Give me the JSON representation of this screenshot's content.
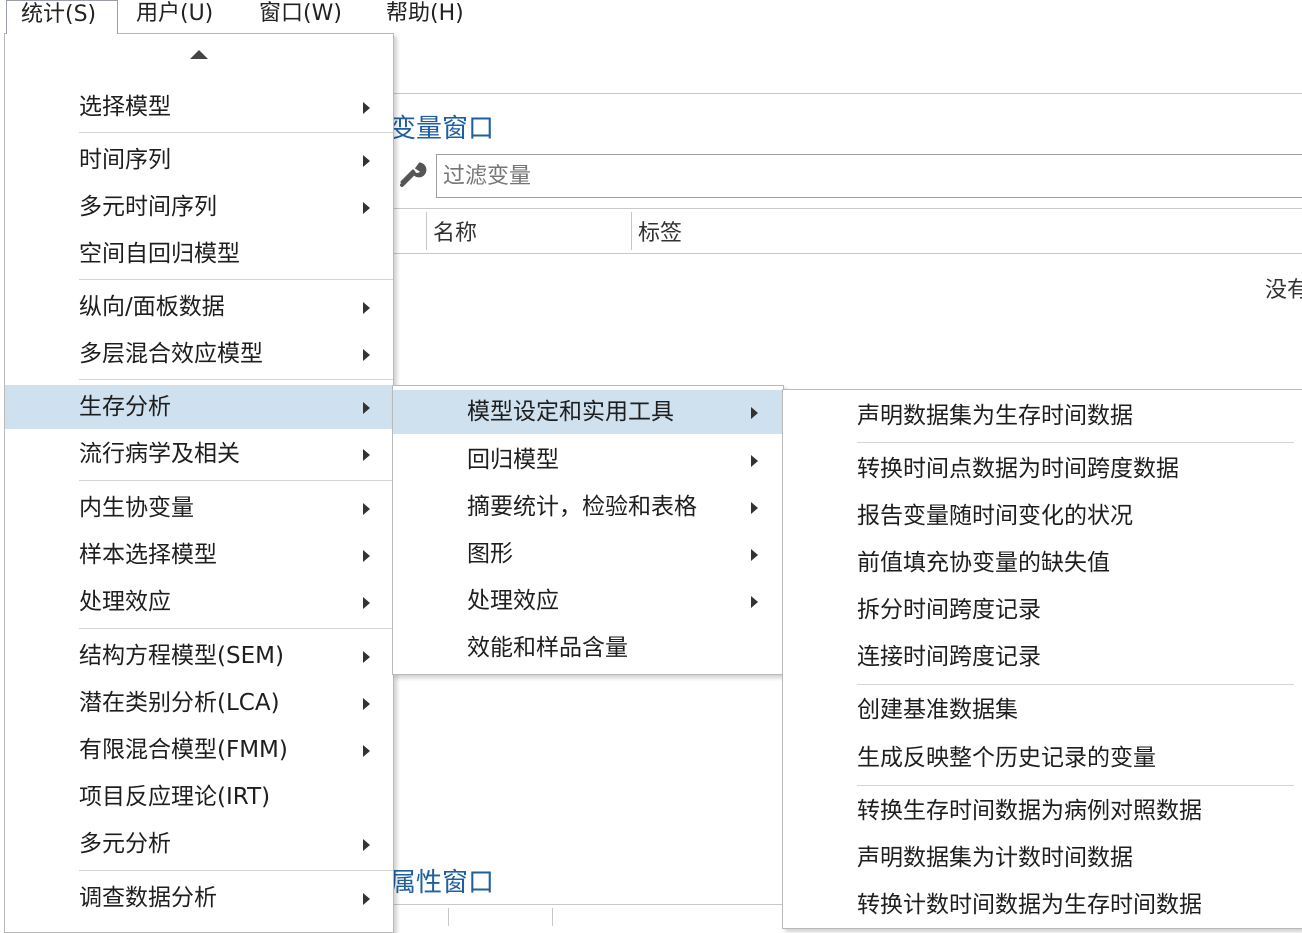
{
  "menubar": {
    "items": [
      {
        "label": "统计(S)"
      },
      {
        "label": "用户(U)"
      },
      {
        "label": "窗口(W)"
      },
      {
        "label": "帮助(H)"
      }
    ]
  },
  "variables_window": {
    "title": "变量窗口",
    "filter_placeholder": "过滤变量",
    "columns": [
      "名称",
      "标签"
    ],
    "empty_text": "没有"
  },
  "properties_window": {
    "title": "属性窗口"
  },
  "main_menu": {
    "items": [
      {
        "label": "选择模型",
        "submenu": true
      },
      {
        "label": "时间序列",
        "submenu": true
      },
      {
        "label": "多元时间序列",
        "submenu": true
      },
      {
        "label": "空间自回归模型",
        "submenu": false
      },
      {
        "label": "纵向/面板数据",
        "submenu": true
      },
      {
        "label": "多层混合效应模型",
        "submenu": true
      },
      {
        "label": "生存分析",
        "submenu": true,
        "highlighted": true
      },
      {
        "label": "流行病学及相关",
        "submenu": true
      },
      {
        "label": "内生协变量",
        "submenu": true
      },
      {
        "label": "样本选择模型",
        "submenu": true
      },
      {
        "label": "处理效应",
        "submenu": true
      },
      {
        "label": "结构方程模型(SEM)",
        "submenu": true
      },
      {
        "label": "潜在类别分析(LCA)",
        "submenu": true
      },
      {
        "label": "有限混合模型(FMM)",
        "submenu": true
      },
      {
        "label": "项目反应理论(IRT)",
        "submenu": false
      },
      {
        "label": "多元分析",
        "submenu": true
      },
      {
        "label": "调查数据分析",
        "submenu": true
      }
    ]
  },
  "survival_menu": {
    "items": [
      {
        "label": "模型设定和实用工具",
        "submenu": true,
        "highlighted": true
      },
      {
        "label": "回归模型",
        "submenu": true
      },
      {
        "label": "摘要统计，检验和表格",
        "submenu": true
      },
      {
        "label": "图形",
        "submenu": true
      },
      {
        "label": "处理效应",
        "submenu": true
      },
      {
        "label": "效能和样品含量",
        "submenu": false
      }
    ]
  },
  "tools_menu": {
    "items": [
      {
        "label": "声明数据集为生存时间数据"
      },
      {
        "label": "转换时间点数据为时间跨度数据"
      },
      {
        "label": "报告变量随时间变化的状况"
      },
      {
        "label": "前值填充协变量的缺失值"
      },
      {
        "label": "拆分时间跨度记录"
      },
      {
        "label": "连接时间跨度记录"
      },
      {
        "label": "创建基准数据集"
      },
      {
        "label": "生成反映整个历史记录的变量"
      },
      {
        "label": "转换生存时间数据为病例对照数据"
      },
      {
        "label": "声明数据集为计数时间数据"
      },
      {
        "label": "转换计数时间数据为生存时间数据"
      }
    ]
  },
  "colors": {
    "highlight": "#cfe0ee",
    "title_blue": "#1f5fa0"
  }
}
